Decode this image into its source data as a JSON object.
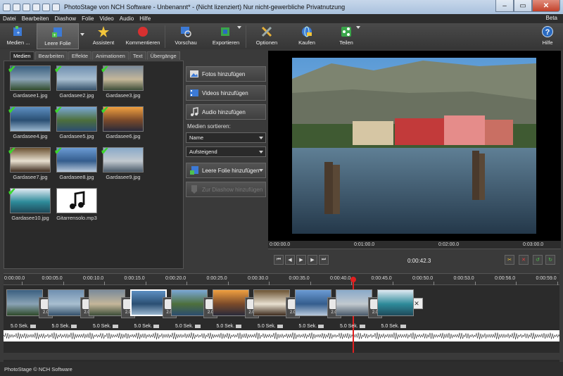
{
  "window": {
    "title": "PhotoStage von NCH Software - Unbenannt* - (Nicht lizenziert) Nur nicht-gewerbliche Privatnutzung"
  },
  "menu": [
    "Datei",
    "Bearbeiten",
    "Diashow",
    "Folie",
    "Video",
    "Audio",
    "Hilfe"
  ],
  "menu_right": "Beta",
  "toolbar": {
    "medien": "Medien ...",
    "leere_folie": "Leere Folie",
    "assistent": "Assistent",
    "kommentieren": "Kommentieren",
    "vorschau": "Vorschau",
    "exportieren": "Exportieren",
    "optionen": "Optionen",
    "kaufen": "Kaufen",
    "teilen": "Teilen",
    "hilfe": "Hilfe"
  },
  "tabs": [
    "Medien",
    "Bearbeiten",
    "Effekte",
    "Animationen",
    "Text",
    "Übergänge"
  ],
  "media": [
    {
      "label": "Gardasee1.jpg",
      "colors": [
        "#3a5f80",
        "#8aa3b5",
        "#2f4a2a"
      ]
    },
    {
      "label": "Gardasee2.jpg",
      "colors": [
        "#6f8fb0",
        "#a9bfd0",
        "#34506a"
      ]
    },
    {
      "label": "Gardasee3.jpg",
      "colors": [
        "#7a8a9a",
        "#c5b79a",
        "#3d4d38"
      ]
    },
    {
      "label": "Gardasee4.jpg",
      "colors": [
        "#5d8fc2",
        "#2a4f73",
        "#9bb7cf"
      ]
    },
    {
      "label": "Gardasee5.jpg",
      "colors": [
        "#7aa7d6",
        "#4d6f3c",
        "#2c4d70"
      ]
    },
    {
      "label": "Gardasee6.jpg",
      "colors": [
        "#f0a040",
        "#7b4a2a",
        "#2a2a3a"
      ]
    },
    {
      "label": "Gardasee7.jpg",
      "colors": [
        "#6b5232",
        "#e8e0d0",
        "#3d2b1d"
      ]
    },
    {
      "label": "Gardasee8.jpg",
      "colors": [
        "#6b9bd4",
        "#345d8d",
        "#b7c8da"
      ]
    },
    {
      "label": "Gardasee9.jpg",
      "colors": [
        "#89a9c9",
        "#c2c9cf",
        "#4a5a6a"
      ]
    },
    {
      "label": "Gardasee10.jpg",
      "colors": [
        "#dfe9f2",
        "#2e8b9a",
        "#1f4a5a"
      ]
    },
    {
      "label": "Gitarrensolo.mp3",
      "colors": [
        "#ffffff",
        "#ffffff",
        "#ffffff"
      ]
    }
  ],
  "side": {
    "fotos": "Fotos hinzufügen",
    "videos": "Videos hinzufügen",
    "audio": "Audio hinzufügen",
    "sort_label": "Medien sortieren:",
    "sort_by": "Name",
    "sort_order": "Aufsteigend",
    "leere_folie": "Leere Folie hinzufügen",
    "zur_diashow": "Zur Diashow hinzufügen"
  },
  "preview_ruler": [
    "0:00:00.0",
    "0:01:00.0",
    "0:02:00.0",
    "0:03:00.0"
  ],
  "player_time": "0:00:42.3",
  "timeline_ticks": [
    "0:00:00.0",
    "0:00:05.0",
    "0:00:10.0",
    "0:00:15.0",
    "0:00:20.0",
    "0:00:25.0",
    "0:00:30.0",
    "0:00:35.0",
    "0:00:40.0",
    "0:00:45.0",
    "0:00:50.0",
    "0:00:53.0",
    "0:00:56.0",
    "0:00:59.0"
  ],
  "slide_duration": "5.0 Sek.",
  "transition_value": "2.0",
  "status": "PhotoStage © NCH Software",
  "colors": {
    "accent": "#3bd62c",
    "playhead": "#e02020"
  }
}
